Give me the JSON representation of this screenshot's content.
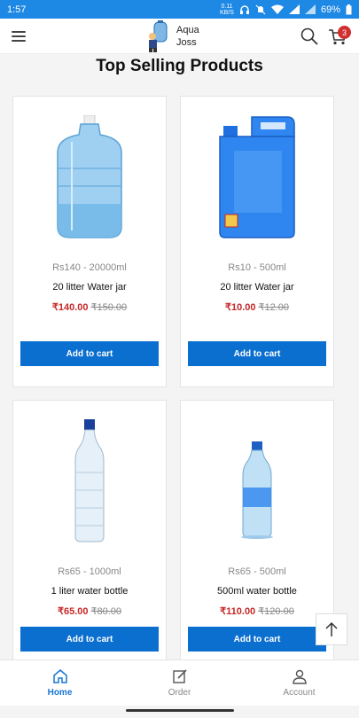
{
  "status": {
    "time": "1:57",
    "speed_value": "0.11",
    "speed_unit": "KB/S",
    "battery": "69%"
  },
  "header": {
    "brand_line1": "Aqua",
    "brand_line2": "Joss",
    "cart_count": "3"
  },
  "section_title": "Top Selling Products",
  "products": [
    {
      "variant": "Rs140 - 20000ml",
      "title": "20 litter Water jar",
      "price": "₹140.00",
      "old_price": "₹150.00",
      "button": "Add to cart"
    },
    {
      "variant": "Rs10 - 500ml",
      "title": "20 litter Water jar",
      "price": "₹10.00",
      "old_price": "₹12.00",
      "button": "Add to cart"
    },
    {
      "variant": "Rs65 - 1000ml",
      "title": "1 liter water bottle",
      "price": "₹65.00",
      "old_price": "₹80.00",
      "button": "Add to cart"
    },
    {
      "variant": "Rs65 - 500ml",
      "title": "500ml water bottle",
      "price": "₹110.00",
      "old_price": "₹120.00",
      "button": "Add to cart"
    }
  ],
  "bottom_nav": [
    {
      "label": "Home",
      "icon": "home-icon",
      "active": true
    },
    {
      "label": "Order",
      "icon": "edit-icon",
      "active": false
    },
    {
      "label": "Account",
      "icon": "user-icon",
      "active": false
    }
  ],
  "colors": {
    "accent": "#0b6fcf",
    "statusbar": "#1e88e5",
    "price": "#c62828",
    "badge": "#d32f2f"
  }
}
